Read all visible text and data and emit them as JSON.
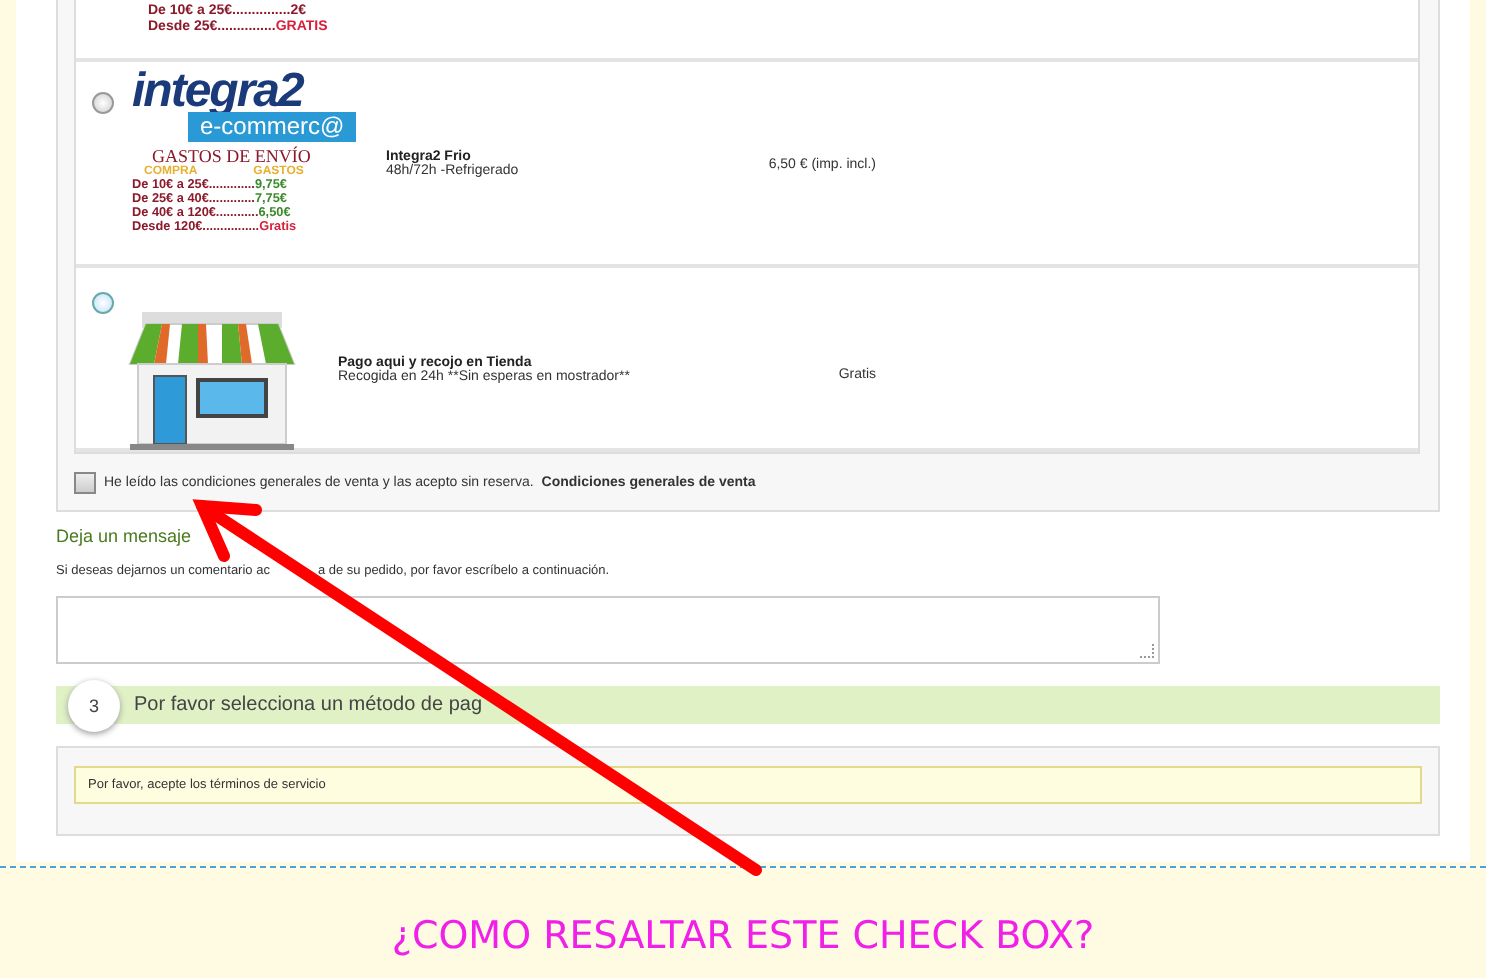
{
  "carriers": [
    {
      "kind": "partial",
      "rates": [
        {
          "range": "De 10€ a 25€...............",
          "price": "2€",
          "color": "#8b1a2b"
        },
        {
          "range": "Desde 25€...............",
          "price": "GRATIS",
          "color": "#d8203a"
        }
      ]
    },
    {
      "kind": "integra",
      "selected": false,
      "logo": {
        "brand": "integra2",
        "tagline": "e-commerc@",
        "heading": "GASTOS DE ENVÍO",
        "col_1": "COMPRA",
        "col_2": "GASTOS",
        "rates": [
          {
            "range": "De 10€ a 25€.............",
            "price": "9,75€",
            "color": "#3a8a2a"
          },
          {
            "range": "De 25€ a 40€.............",
            "price": "7,75€",
            "color": "#3a8a2a"
          },
          {
            "range": "De 40€ a 120€............",
            "price": "6,50€",
            "color": "#3a8a2a"
          },
          {
            "range": "Desde 120€................",
            "price": "Gratis",
            "color": "#d8203a"
          }
        ]
      },
      "name": "Integra2 Frio",
      "detail": "48h/72h -Refrigerado",
      "price": "6,50 € (imp. incl.)"
    },
    {
      "kind": "store",
      "selected": false,
      "name": "Pago aqui y recojo en Tienda",
      "detail": "Recogida en 24h **Sin esperas en mostrador**",
      "price": "Gratis"
    }
  ],
  "terms": {
    "checked": false,
    "label": "He leído las condiciones generales de venta y las acepto sin reserva.",
    "link": "Condiciones generales de venta"
  },
  "message": {
    "heading": "Deja un mensaje",
    "hint": [
      "Si deseas dejarnos un comentario ac",
      "a de su pedido, por favor escríbelo a continuación."
    ]
  },
  "payment_step": {
    "number": "3",
    "title": "Por favor selecciona un método de pag",
    "notice": "Por favor, acepte los términos de servicio"
  },
  "caption": "¿COMO RESALTAR ESTE CHECK BOX?"
}
